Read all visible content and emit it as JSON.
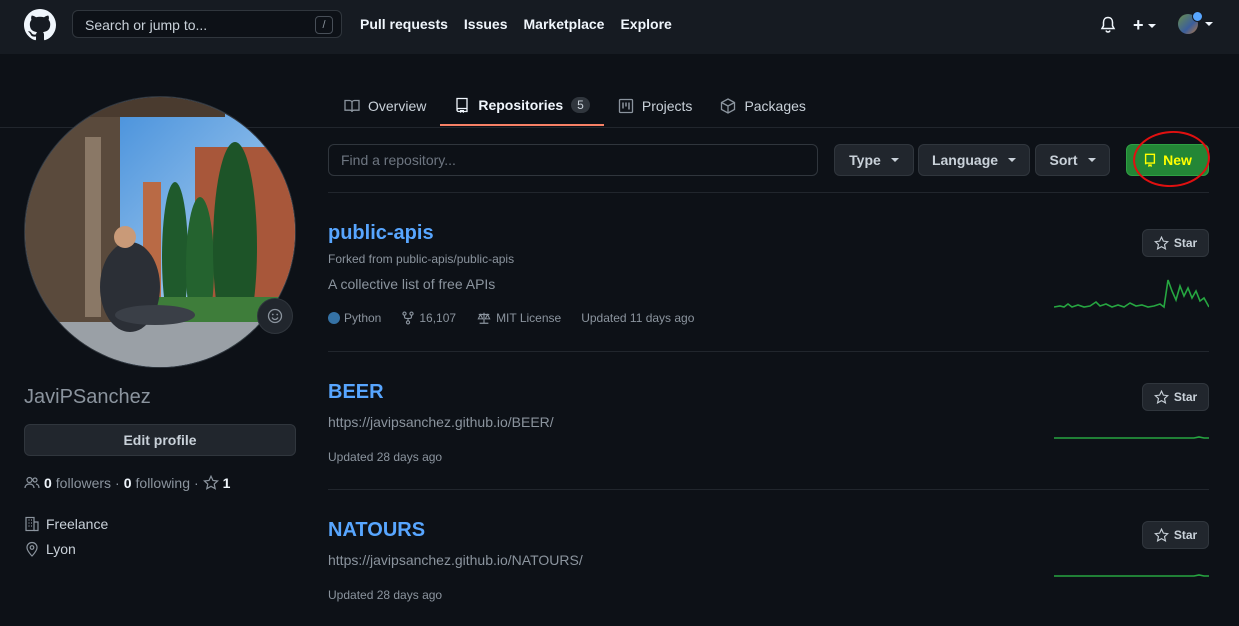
{
  "header": {
    "search_placeholder": "Search or jump to...",
    "search_shortcut": "/",
    "nav": [
      "Pull requests",
      "Issues",
      "Marketplace",
      "Explore"
    ],
    "plus_label": "+"
  },
  "tabs": [
    {
      "label": "Overview"
    },
    {
      "label": "Repositories",
      "count": "5"
    },
    {
      "label": "Projects"
    },
    {
      "label": "Packages"
    }
  ],
  "profile": {
    "username": "JaviPSanchez",
    "edit_label": "Edit profile",
    "followers_count": "0",
    "followers_label": "followers",
    "separator": "·",
    "following_count": "0",
    "following_label": "following",
    "stars_count": "1",
    "company": "Freelance",
    "location": "Lyon"
  },
  "filters": {
    "find_placeholder": "Find a repository...",
    "type_label": "Type",
    "language_label": "Language",
    "sort_label": "Sort",
    "new_label": "New"
  },
  "repos": [
    {
      "name": "public-apis",
      "forked_from": "Forked from public-apis/public-apis",
      "description": "A collective list of free APIs",
      "language": "Python",
      "forks": "16,107",
      "license": "MIT License",
      "updated": "Updated 11 days ago",
      "star_label": "Star"
    },
    {
      "name": "BEER",
      "description": "https://javipsanchez.github.io/BEER/",
      "updated": "Updated 28 days ago",
      "star_label": "Star"
    },
    {
      "name": "NATOURS",
      "description": "https://javipsanchez.github.io/NATOURS/",
      "updated": "Updated 28 days ago",
      "star_label": "Star"
    }
  ],
  "colors": {
    "accent_link": "#58a6ff",
    "new_button": "#238636",
    "new_text": "#ffff00",
    "annotation": "#e01010",
    "python": "#3572A5",
    "tab_underline": "#f78166"
  }
}
